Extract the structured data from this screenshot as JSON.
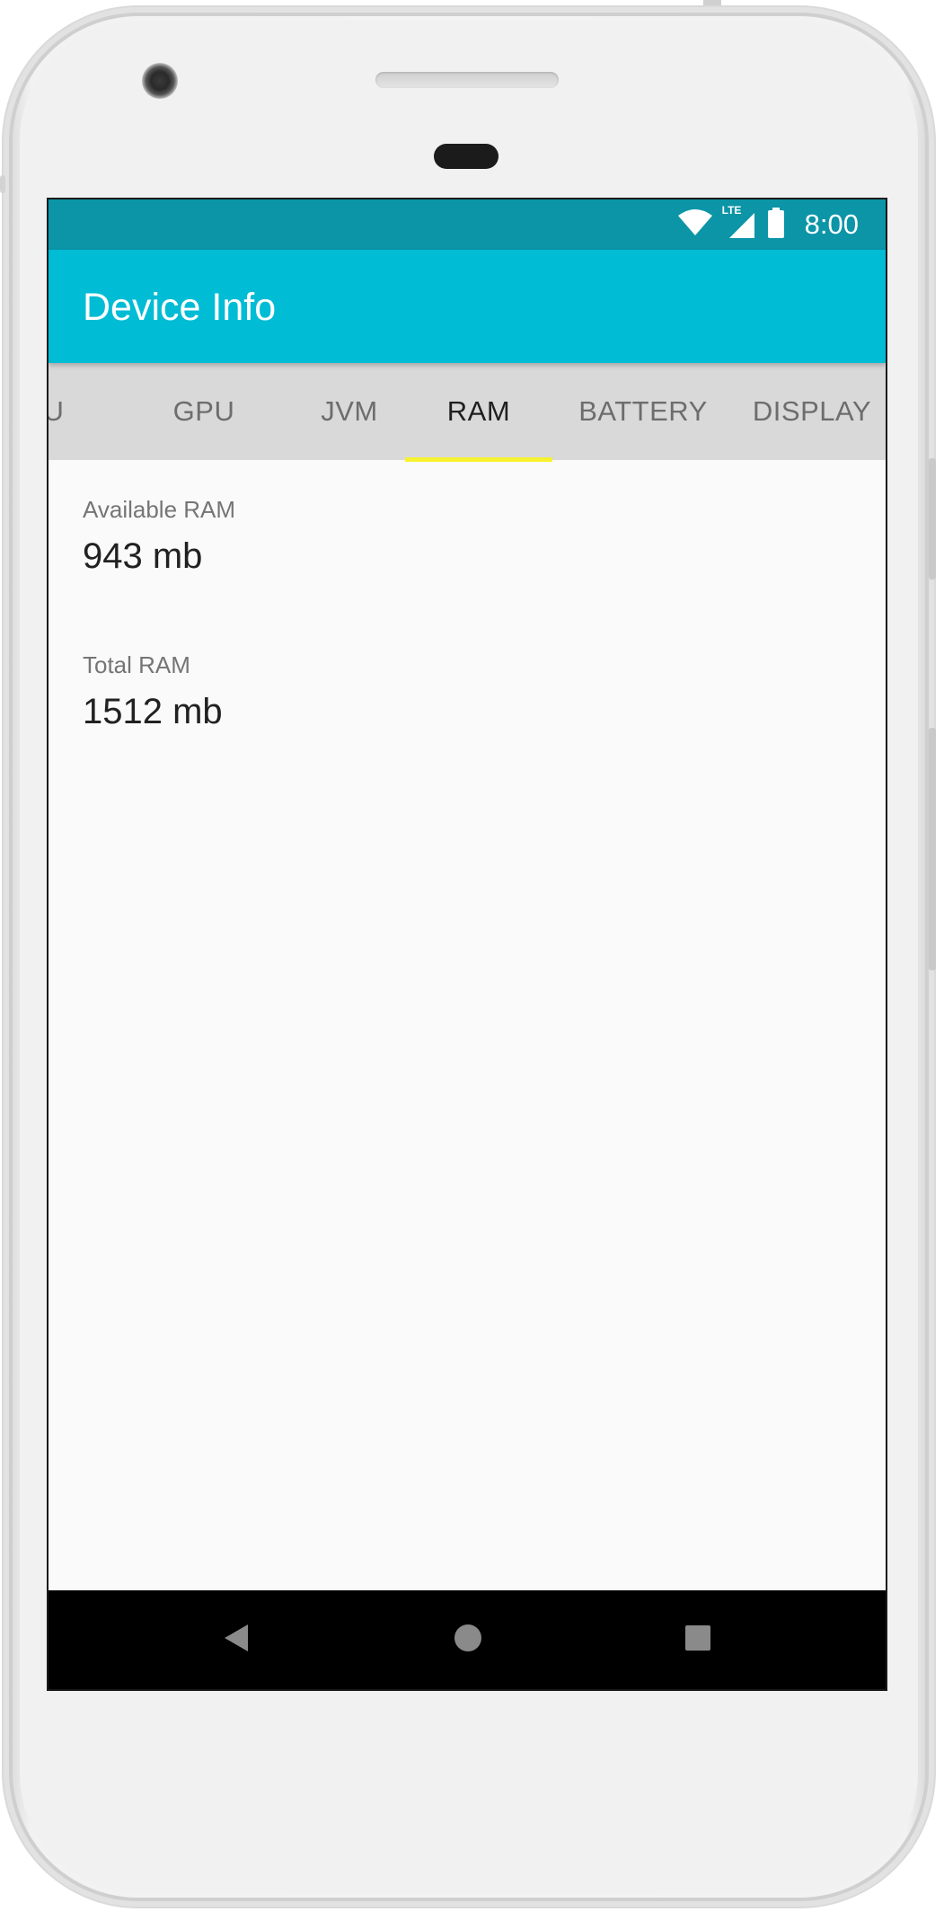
{
  "status_bar": {
    "time": "8:00",
    "network_label": "LTE"
  },
  "app_bar": {
    "title": "Device Info"
  },
  "tabs": [
    {
      "label": "U"
    },
    {
      "label": "GPU"
    },
    {
      "label": "JVM"
    },
    {
      "label": "RAM",
      "active": true
    },
    {
      "label": "BATTERY"
    },
    {
      "label": "DISPLAY"
    }
  ],
  "ram": {
    "available": {
      "label": "Available RAM",
      "value": "943 mb"
    },
    "total": {
      "label": "Total RAM",
      "value": "1512 mb"
    }
  },
  "colors": {
    "status_bar": "#0b95a7",
    "app_bar": "#00bcd4",
    "tab_bar": "#d9d9d9",
    "tab_indicator": "#f6f22e",
    "nav_bar": "#000000"
  },
  "icons": {
    "status": [
      "wifi-icon",
      "lte-signal-icon",
      "battery-icon"
    ],
    "navigation": [
      "back-icon",
      "home-icon",
      "recents-icon"
    ]
  }
}
